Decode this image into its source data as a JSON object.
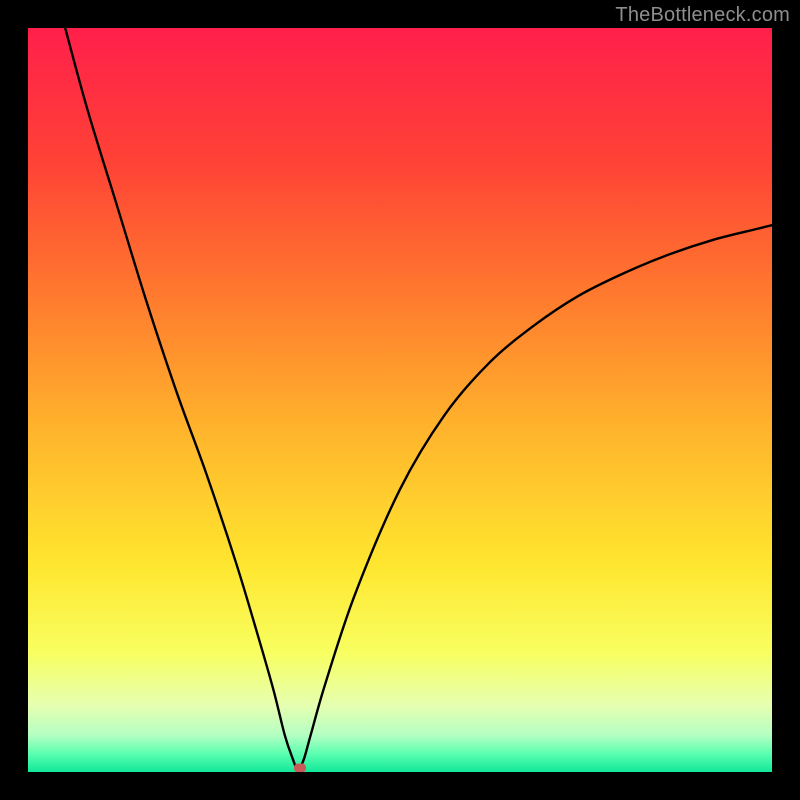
{
  "watermark": "TheBottleneck.com",
  "chart_data": {
    "type": "line",
    "title": "",
    "xlabel": "",
    "ylabel": "",
    "xlim": [
      0,
      100
    ],
    "ylim": [
      0,
      100
    ],
    "gradient_stops": [
      {
        "pct": 0,
        "color": "#ff1f4b"
      },
      {
        "pct": 18,
        "color": "#ff4236"
      },
      {
        "pct": 36,
        "color": "#ff7a2e"
      },
      {
        "pct": 55,
        "color": "#ffb72c"
      },
      {
        "pct": 72,
        "color": "#ffe62f"
      },
      {
        "pct": 84,
        "color": "#f8ff60"
      },
      {
        "pct": 91,
        "color": "#e6ffb0"
      },
      {
        "pct": 95,
        "color": "#b6ffc3"
      },
      {
        "pct": 97.5,
        "color": "#5dffb0"
      },
      {
        "pct": 100,
        "color": "#12e89a"
      }
    ],
    "series": [
      {
        "name": "bottleneck-curve",
        "x": [
          5,
          8,
          12,
          16,
          20,
          24,
          28,
          31,
          33,
          34.5,
          35.5,
          36.2,
          37,
          38,
          40,
          44,
          50,
          56,
          62,
          68,
          74,
          80,
          86,
          92,
          98,
          100
        ],
        "y": [
          100,
          89,
          76,
          63,
          51,
          40,
          28,
          18,
          11,
          5,
          2,
          0.5,
          1.5,
          5,
          12,
          24,
          38,
          48,
          55,
          60,
          64,
          67,
          69.5,
          71.5,
          73,
          73.5
        ]
      }
    ],
    "marker": {
      "x": 36.5,
      "y": 0.6,
      "color": "#c85a57"
    }
  }
}
